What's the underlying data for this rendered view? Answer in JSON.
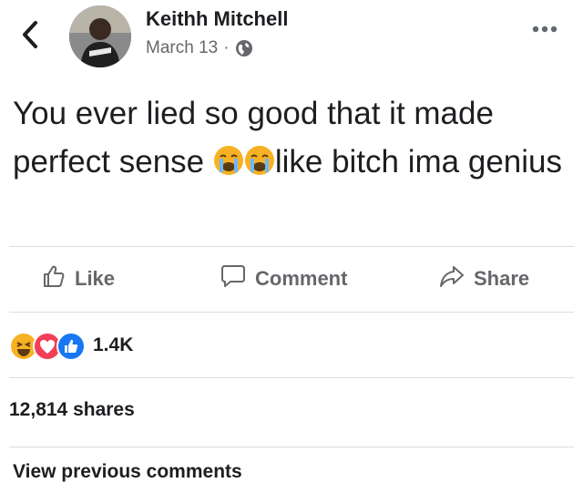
{
  "post": {
    "author": "Keithh Mitchell",
    "date": "March 13",
    "separator": "·",
    "privacy_icon": "globe-icon",
    "text_part1": "You ever lied so good that it made perfect sense ",
    "emoji": "loudly-crying-face",
    "text_part2": "like bitch ima genius"
  },
  "actions": {
    "like_label": "Like",
    "comment_label": "Comment",
    "share_label": "Share"
  },
  "stats": {
    "reactions_count": "1.4K",
    "reaction_icons": [
      "haha-icon",
      "love-icon",
      "like-icon"
    ],
    "shares_text": "12,814 shares",
    "previous_comments_label": "View previous comments"
  },
  "colors": {
    "text": "#1c1e21",
    "secondary_text": "#65676b",
    "like_blue": "#1877f2",
    "love_red": "#f33e58",
    "haha_yellow": "#f7b125",
    "divider": "#dadde1"
  }
}
